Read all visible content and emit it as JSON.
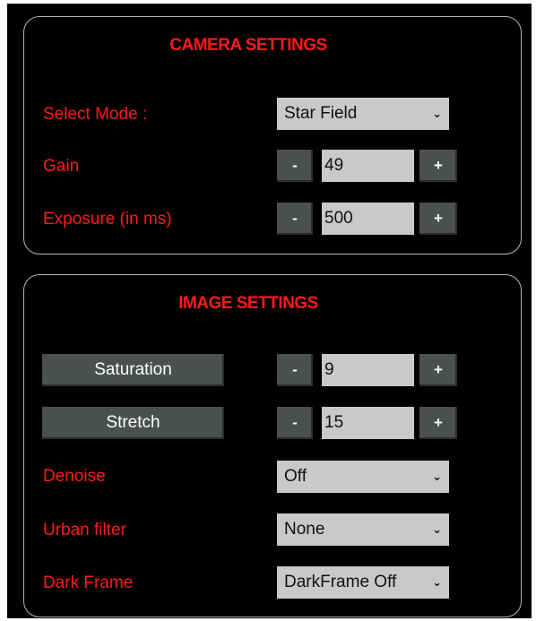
{
  "camera": {
    "title": "CAMERA SETTINGS",
    "mode_label": "Select Mode :",
    "mode_value": "Star Field",
    "gain_label": "Gain",
    "gain_value": "49",
    "exposure_label": "Exposure (in ms)",
    "exposure_value": "500"
  },
  "image": {
    "title": "IMAGE SETTINGS",
    "saturation_label": "Saturation",
    "saturation_value": "9",
    "stretch_label": "Stretch",
    "stretch_value": "15",
    "denoise_label": "Denoise",
    "denoise_value": "Off",
    "urban_label": "Urban filter",
    "urban_value": "None",
    "dark_label": "Dark Frame",
    "dark_value": "DarkFrame Off"
  },
  "controls": {
    "minus": "-",
    "plus": "+",
    "chevron": "⌄"
  },
  "colors": {
    "label_red": "#ff1a1a",
    "button_gray": "#4b4f50",
    "field_gray": "#c9c9c9",
    "border": "#b5b5b5",
    "background": "#000000"
  }
}
